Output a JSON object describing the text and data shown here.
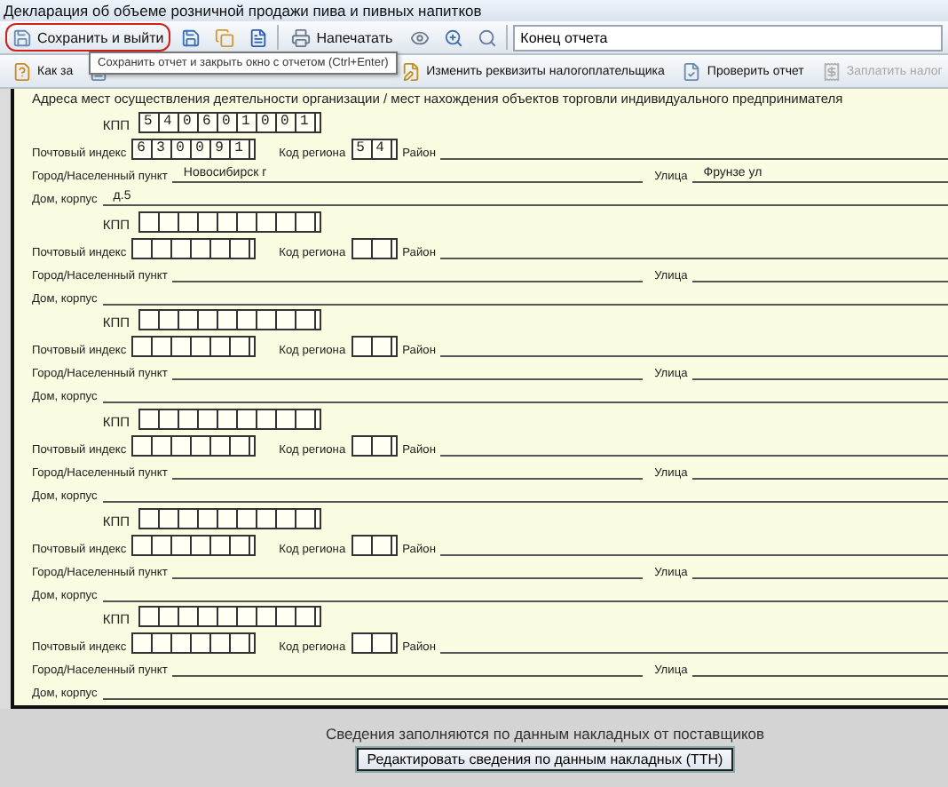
{
  "window": {
    "title": "Декларация об объеме розничной продажи пива и пивных напитков"
  },
  "toolbar": [
    {
      "kind": "button",
      "label": "Сохранить и выйти",
      "highlighted": true
    },
    {
      "kind": "icon"
    },
    {
      "kind": "icon"
    },
    {
      "kind": "dropdown"
    },
    {
      "kind": "button",
      "label": "Напечатать",
      "highlighted": false
    },
    {
      "kind": "icon"
    },
    {
      "kind": "icon"
    },
    {
      "kind": "icon"
    },
    {
      "kind": "field",
      "value": "Конец отчета"
    }
  ],
  "tooltip": "Сохранить отчет и закрыть окно с отчетом (Ctrl+Enter)",
  "actions": [
    {
      "kind": "button",
      "label": "Как за",
      "disabled": false
    },
    {
      "kind": "icon"
    },
    {
      "kind": "button",
      "label": "Изменить реквизиты налогоплательщика",
      "disabled": false
    },
    {
      "kind": "button",
      "label": "Проверить отчет",
      "disabled": false
    },
    {
      "kind": "button",
      "label": "Заплатить налог",
      "disabled": true
    }
  ],
  "form": {
    "heading": "Адреса мест осуществления деятельности организации / мест нахождения объектов торговли индивидуального предпринимателя",
    "addresses": [
      {
        "kpp_label": "КПП",
        "kpp": "540601001",
        "index_label": "Почтовый индекс",
        "index": "630091",
        "region_label": "Код региона",
        "region": "54",
        "district_label": "Район",
        "city_label": "Город/Населенный пункт",
        "city": "Новосибирск г",
        "street_label": "Улица",
        "street": "Фрунзе ул",
        "house_label": "Дом, корпус",
        "house": "д.5"
      },
      {
        "kpp_label": "КПП",
        "index_label": "Почтовый индекс",
        "region_label": "Код региона",
        "district_label": "Район",
        "city_label": "Город/Населенный пункт",
        "street_label": "Улица",
        "house_label": "Дом, корпус"
      },
      {
        "kpp_label": "КПП",
        "index_label": "Почтовый индекс",
        "region_label": "Код региона",
        "district_label": "Район",
        "city_label": "Город/Населенный пункт",
        "street_label": "Улица",
        "house_label": "Дом, корпус"
      },
      {
        "kpp_label": "КПП",
        "index_label": "Почтовый индекс",
        "region_label": "Код региона",
        "district_label": "Район",
        "city_label": "Город/Населенный пункт",
        "street_label": "Улица",
        "house_label": "Дом, корпус"
      },
      {
        "kpp_label": "КПП",
        "index_label": "Почтовый индекс",
        "region_label": "Код региона",
        "district_label": "Район",
        "city_label": "Город/Населенный пункт",
        "street_label": "Улица",
        "house_label": "Дом, корпус"
      },
      {
        "kpp_label": "КПП",
        "index_label": "Почтовый индекс",
        "region_label": "Код региона",
        "district_label": "Район",
        "city_label": "Город/Населенный пункт",
        "street_label": "Улица",
        "house_label": "Дом, корпус"
      }
    ]
  },
  "footer": {
    "note": "Сведения заполняются по данным накладных от поставщиков",
    "button": "Редактировать сведения по данным накладных (ТТН)"
  }
}
